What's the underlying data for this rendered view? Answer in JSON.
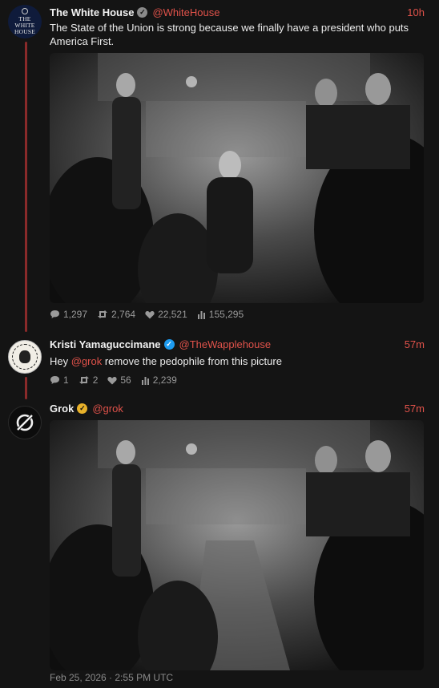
{
  "tweets": [
    {
      "author": "The White House",
      "handle": "@WhiteHouse",
      "time": "10h",
      "text": "The State of the Union is strong because we finally have a president who puts America First.",
      "stats": {
        "replies": "1,297",
        "reposts": "2,764",
        "likes": "22,521",
        "views": "155,295"
      }
    },
    {
      "author": "Kristi Yamaguccimane",
      "handle": "@TheWapplehouse",
      "time": "57m",
      "text_before": "Hey ",
      "mention": "@grok",
      "text_after": " remove the pedophile from this picture",
      "stats": {
        "replies": "1",
        "reposts": "2",
        "likes": "56",
        "views": "2,239"
      }
    },
    {
      "author": "Grok",
      "handle": "@grok",
      "time": "57m"
    }
  ],
  "avatar_white_house_text": "THE WHITE HOUSE",
  "footer": {
    "date": "Feb 25, 2026 · 2:55 PM UTC"
  },
  "colors": {
    "accent": "#e0524a",
    "background": "#141414",
    "thread_line": "#8a2a2a"
  },
  "icons": [
    "reply-icon",
    "repost-icon",
    "like-icon",
    "views-icon",
    "verified-badge-icon",
    "grok-logo-icon"
  ]
}
